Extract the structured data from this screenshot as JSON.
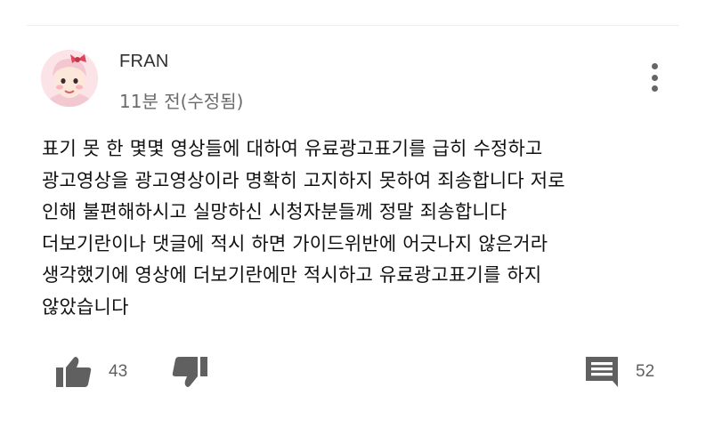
{
  "comment": {
    "author": "FRAN",
    "timestamp": "11분 전(수정됨)",
    "lines": [
      "표기 못 한 몇몇 영상들에 대하여 유료광고표기를 급히 수정하고",
      "광고영상을 광고영상이라 명확히 고지하지 못하여 죄송합니다 저로",
      "인해 불편해하시고 실망하신 시청자분들께 정말 죄송합니다",
      "더보기란이나 댓글에 적시 하면 가이드위반에 어긋나지 않은거라",
      "생각했기에 영상에 더보기란에만 적시하고 유료광고표기를 하지",
      "않았습니다"
    ],
    "likes": "43",
    "replies": "52"
  },
  "icons": {
    "avatar": "avatar-image",
    "menu": "more-vertical-icon",
    "like": "thumbs-up-icon",
    "dislike": "thumbs-down-icon",
    "reply": "comment-icon"
  },
  "colors": {
    "text": "#111111",
    "muted": "#606060",
    "icon": "#606060"
  }
}
